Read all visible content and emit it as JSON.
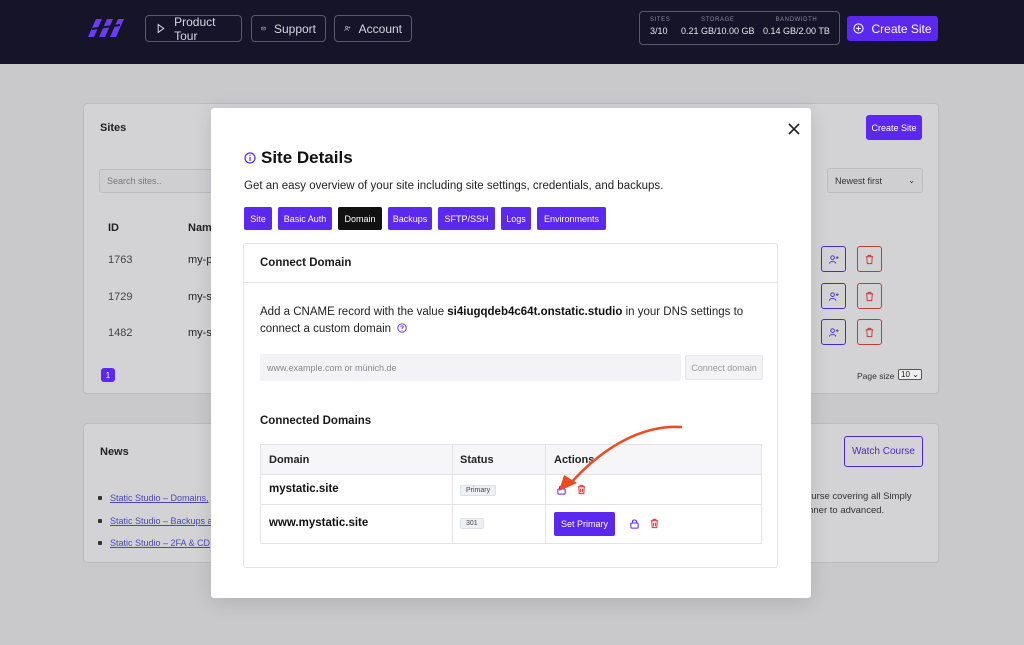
{
  "topbar": {
    "nav": [
      {
        "label": "Product Tour",
        "icon": "play-icon"
      },
      {
        "label": "Support",
        "icon": "mail-icon"
      },
      {
        "label": "Account",
        "icon": "user-plus-icon"
      }
    ],
    "stats": [
      {
        "key": "SITES",
        "value": "3/10"
      },
      {
        "key": "STORAGE",
        "value": "0.21 GB/10.00 GB"
      },
      {
        "key": "BANDWIDTH",
        "value": "0.14 GB/2.00 TB"
      }
    ],
    "create_label": "Create Site"
  },
  "sites_card": {
    "title": "Sites",
    "create_label": "Create Site",
    "search_placeholder": "Search sites..",
    "sort_value": "Newest first",
    "columns": [
      "ID",
      "Nam"
    ],
    "rows": [
      {
        "id": "1763",
        "name": "my-p"
      },
      {
        "id": "1729",
        "name": "my-s"
      },
      {
        "id": "1482",
        "name": "my-s"
      }
    ],
    "page": "1",
    "page_size_label": "Page size",
    "page_size_value": "10"
  },
  "news_card": {
    "title": "News",
    "watch_label": "Watch Course",
    "links": [
      "Static Studio – Domains,",
      "Static Studio – Backups a",
      "Static Studio – 2FA & CD"
    ],
    "desc_line1": "ourse covering all Simply",
    "desc_line2": "inner to advanced."
  },
  "modal": {
    "title": "Site Details",
    "subtitle": "Get an easy overview of your site including site settings, credentials, and backups.",
    "tabs": [
      "Site",
      "Basic Auth",
      "Domain",
      "Backups",
      "SFTP/SSH",
      "Logs",
      "Environments"
    ],
    "active_tab": "Domain",
    "connect_title": "Connect Domain",
    "cname_pre": "Add a CNAME record with the value ",
    "cname_value": "si4iugqdeb4c64t.onstatic.studio",
    "cname_post": " in your DNS settings to connect a custom domain",
    "domain_placeholder": "www.example.com or münich.de",
    "connect_button": "Connect domain",
    "connected_title": "Connected Domains",
    "table_headers": [
      "Domain",
      "Status",
      "Actions"
    ],
    "domains": [
      {
        "domain": "mystatic.site",
        "status": "Primary"
      },
      {
        "domain": "www.mystatic.site",
        "status": "301",
        "action": "Set Primary"
      }
    ]
  },
  "colors": {
    "accent": "#5b28f0",
    "topbar": "#161428",
    "danger": "#d93535"
  }
}
